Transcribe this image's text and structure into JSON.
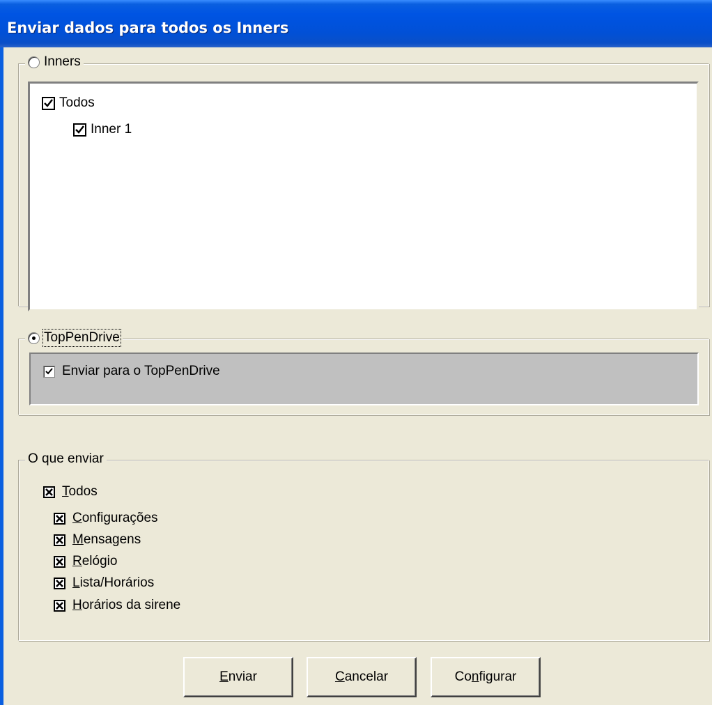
{
  "window": {
    "title": "Enviar dados para todos os Inners"
  },
  "inners_group": {
    "label": "Inners",
    "selected": false,
    "tree": [
      {
        "label": "Todos",
        "checked": true,
        "level": 0
      },
      {
        "label": "Inner 1",
        "checked": true,
        "level": 1
      }
    ]
  },
  "toppendrive_group": {
    "label": "TopPenDrive",
    "selected": true,
    "checkbox_label": "Enviar para o TopPenDrive",
    "checkbox_checked": true
  },
  "what_to_send_group": {
    "label": "O que enviar",
    "all": {
      "pre": "",
      "ul": "T",
      "post": "odos",
      "checked": true
    },
    "items": [
      {
        "pre": "",
        "ul": "C",
        "post": "onfigurações",
        "checked": true
      },
      {
        "pre": "",
        "ul": "M",
        "post": "ensagens",
        "checked": true
      },
      {
        "pre": "",
        "ul": "R",
        "post": "elógio",
        "checked": true
      },
      {
        "pre": "",
        "ul": "L",
        "post": "ista/Horários",
        "checked": true
      },
      {
        "pre": "",
        "ul": "H",
        "post": "orários da sirene",
        "checked": true
      }
    ]
  },
  "buttons": {
    "send": {
      "pre": "",
      "ul": "E",
      "post": "nviar"
    },
    "cancel": {
      "pre": "",
      "ul": "C",
      "post": "ancelar"
    },
    "configure": {
      "pre": "Co",
      "ul": "n",
      "post": "figurar"
    }
  }
}
